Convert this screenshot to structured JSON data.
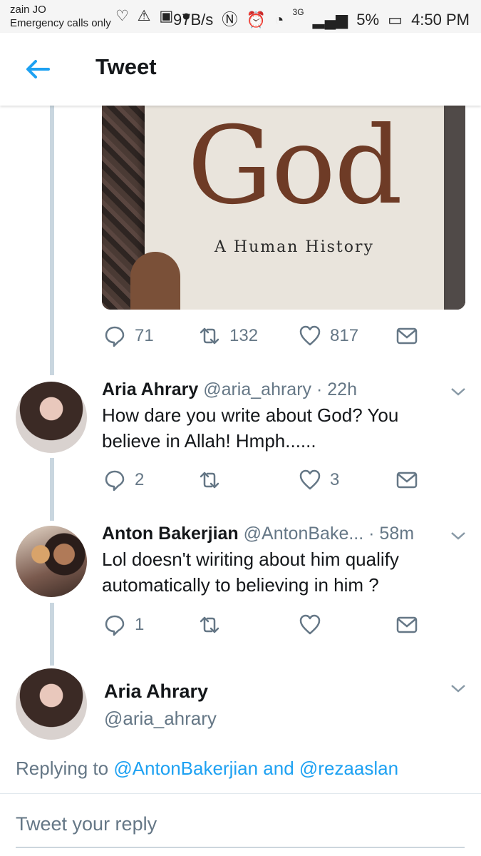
{
  "status_bar": {
    "carrier": "zain JO",
    "emergency": "Emergency calls only",
    "speed": "97B/s",
    "network": "3G",
    "battery": "5%",
    "time": "4:50 PM"
  },
  "header": {
    "title": "Tweet"
  },
  "media": {
    "book_title": "God",
    "book_subtitle": "A Human History"
  },
  "main_tweet_actions": {
    "replies": "71",
    "retweets": "132",
    "likes": "817"
  },
  "replies": [
    {
      "name": "Aria Ahrary",
      "handle": "@aria_ahrary",
      "time": "· 22h",
      "text": "How dare you write about God? You believe in Allah! Hmph......",
      "replies": "2",
      "retweets": "",
      "likes": "3"
    },
    {
      "name": "Anton Bakerjian",
      "handle": "@AntonBake...",
      "time": "· 58m",
      "text": "Lol doesn't wiriting about him qualify automatically to believing in him ?",
      "replies": "1",
      "retweets": "",
      "likes": ""
    }
  ],
  "focused_tweet": {
    "name": "Aria Ahrary",
    "handle": "@aria_ahrary",
    "replying_prefix": "Replying to",
    "replying_user1": "@AntonBakerjian",
    "replying_and": "and",
    "replying_user2": "@rezaaslan"
  },
  "composer": {
    "placeholder": "Tweet your reply"
  },
  "colors": {
    "accent": "#1da1f2",
    "muted": "#657786",
    "thread": "#c9d6df"
  }
}
